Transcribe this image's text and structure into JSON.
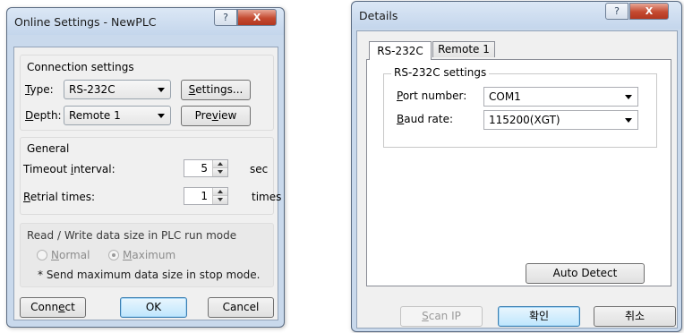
{
  "online_dialog": {
    "title": "Online Settings - NewPLC",
    "help_glyph": "?",
    "close_glyph": "X",
    "connection": {
      "group_title": "Connection settings",
      "type_label_key": "T",
      "type_label_rest": "ype:",
      "type_value": "RS-232C",
      "settings_key": "S",
      "settings_rest": "ettings...",
      "depth_label_key": "D",
      "depth_label_rest": "epth:",
      "depth_value": "Remote 1",
      "preview_pre": "Pre",
      "preview_key": "v",
      "preview_post": "iew"
    },
    "general": {
      "group_title": "General",
      "timeout_pre": "Timeout ",
      "timeout_key": "i",
      "timeout_post": "nterval:",
      "timeout_value": "5",
      "timeout_unit": "sec",
      "retrial_key": "R",
      "retrial_rest": "etrial times:",
      "retrial_value": "1",
      "retrial_unit": "times"
    },
    "read_write": {
      "group_title": "Read / Write data size in PLC run mode",
      "normal_key": "N",
      "normal_rest": "ormal",
      "maximum_key": "M",
      "maximum_rest": "aximum",
      "selected": "maximum",
      "note": "* Send maximum data size in stop mode."
    },
    "buttons": {
      "connect_pre": "Conn",
      "connect_key": "e",
      "connect_post": "ct",
      "ok": "OK",
      "cancel": "Cancel"
    }
  },
  "details_dialog": {
    "title": "Details",
    "help_glyph": "?",
    "close_glyph": "X",
    "tabs": [
      "RS-232C",
      "Remote 1"
    ],
    "active_tab": "RS-232C",
    "group_title": "RS-232C settings",
    "port_label_key": "P",
    "port_label_rest": "ort number:",
    "port_value": "COM1",
    "baud_label_key": "B",
    "baud_label_rest": "aud rate:",
    "baud_value": "115200(XGT)",
    "auto_detect": "Auto Detect",
    "scan_ip_key": "S",
    "scan_ip_rest": "can IP",
    "ok": "확인",
    "cancel": "취소"
  }
}
